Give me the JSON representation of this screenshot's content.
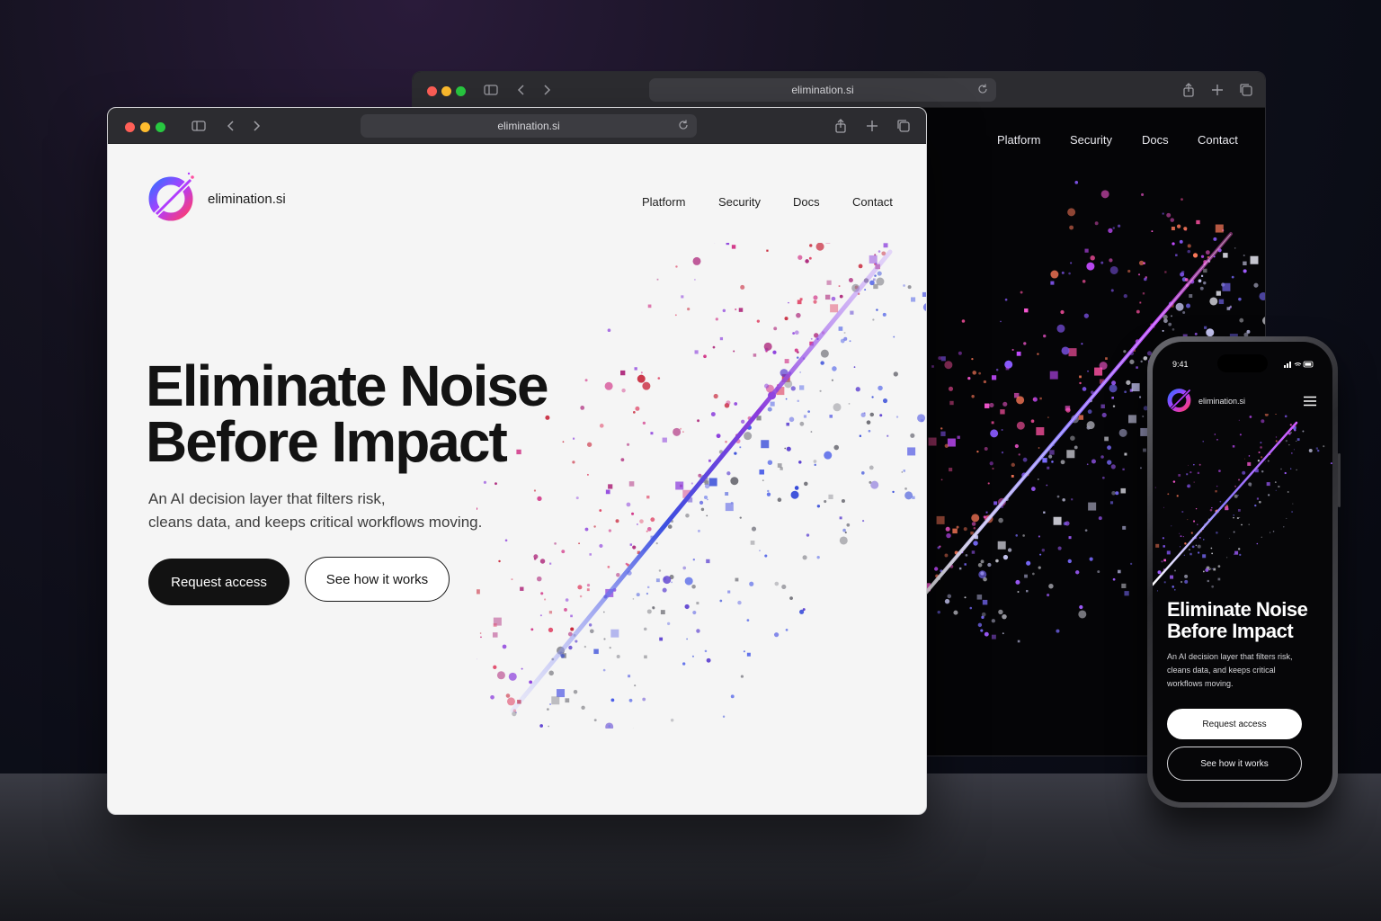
{
  "url": "elimination.si",
  "brand": "elimination.si",
  "nav": [
    "Platform",
    "Security",
    "Docs",
    "Contact"
  ],
  "hero": {
    "title_line1": "Eliminate Noise",
    "title_line2": "Before Impact",
    "subtitle_line1": "An AI decision layer that filters risk,",
    "subtitle_line2": "cleans data, and keeps critical workflows moving.",
    "primary_cta": "Request access",
    "secondary_cta": "See how it works"
  },
  "phone": {
    "time": "9:41",
    "brand": "elimination.si",
    "title_line1": "Eliminate Noise",
    "title_line2": "Before Impact",
    "subtitle_line1": "An AI decision layer that filters risk,",
    "subtitle_line2": "cleans data, and keeps critical",
    "subtitle_line3": "workflows moving.",
    "primary_cta": "Request access",
    "secondary_cta": "See how it works"
  },
  "colors": {
    "accent_blue": "#3b4fe0",
    "accent_purple": "#8a3bdc",
    "accent_magenta": "#d23aa8",
    "accent_red": "#c8263a"
  },
  "icons": [
    "sidebar-icon",
    "back-icon",
    "forward-icon",
    "reload-icon",
    "share-icon",
    "new-tab-icon",
    "tabs-icon",
    "menu-icon"
  ]
}
